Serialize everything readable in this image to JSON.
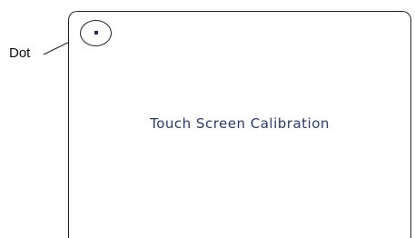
{
  "callout": {
    "label": "Dot"
  },
  "screen": {
    "title": "Touch Screen Calibration",
    "title_color": "#243c74",
    "dot_color": "#1a2b5c"
  }
}
